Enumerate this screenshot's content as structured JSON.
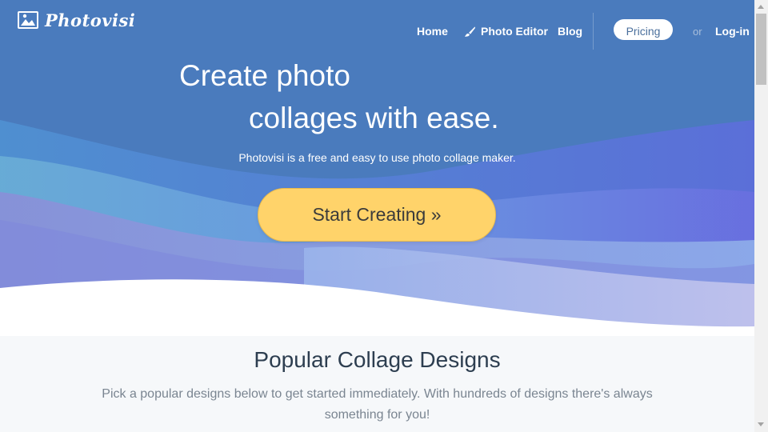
{
  "brand": {
    "name": "Photovisi",
    "logo_icon": "photo-frame-icon"
  },
  "nav": {
    "home": "Home",
    "photo_editor": "Photo Editor",
    "photo_editor_icon": "brush-icon",
    "blog": "Blog",
    "pricing": "Pricing",
    "or": "or",
    "login": "Log-in"
  },
  "hero": {
    "title_line1": "Create photo",
    "title_line2": "collages with ease.",
    "subtitle": "Photovisi is a free and easy to use photo collage maker.",
    "cta": "Start Creating »",
    "colors": {
      "background": "#4a7bbd",
      "cta": "#ffd36a"
    }
  },
  "popular": {
    "title": "Popular Collage Designs",
    "description": "Pick a popular designs below to get started immediately. With hundreds of designs there's always something for you!"
  }
}
